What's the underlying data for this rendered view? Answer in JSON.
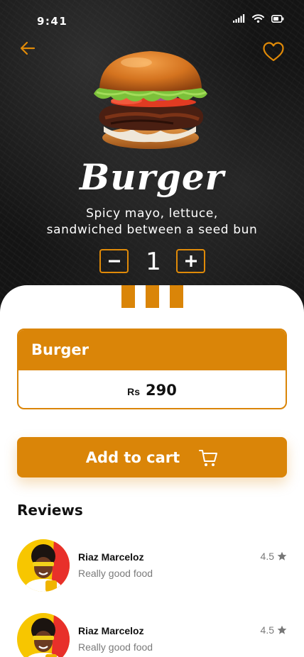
{
  "status_bar": {
    "time": "9:41"
  },
  "product": {
    "name": "Burger",
    "description_line1": "Spicy mayo, lettuce,",
    "description_line2": "sandwiched between a seed bun",
    "quantity": "1"
  },
  "price_card": {
    "title": "Burger",
    "currency": "Rs",
    "amount": "290"
  },
  "add_to_cart": {
    "label": "Add to cart"
  },
  "reviews": {
    "title": "Reviews",
    "items": [
      {
        "name": "Riaz Marceloz",
        "text": "Really good food",
        "rating": "4.5"
      },
      {
        "name": "Riaz Marceloz",
        "text": "Really good food",
        "rating": "4.5"
      }
    ]
  },
  "icons": {
    "back": "arrow-left-icon",
    "favorite": "heart-icon",
    "minus": "minus-icon",
    "plus": "plus-icon",
    "cart": "cart-icon",
    "star": "star-icon"
  },
  "colors": {
    "accent": "#DA8508",
    "hero_bg": "#141414",
    "text_muted": "#7a7a7a"
  }
}
